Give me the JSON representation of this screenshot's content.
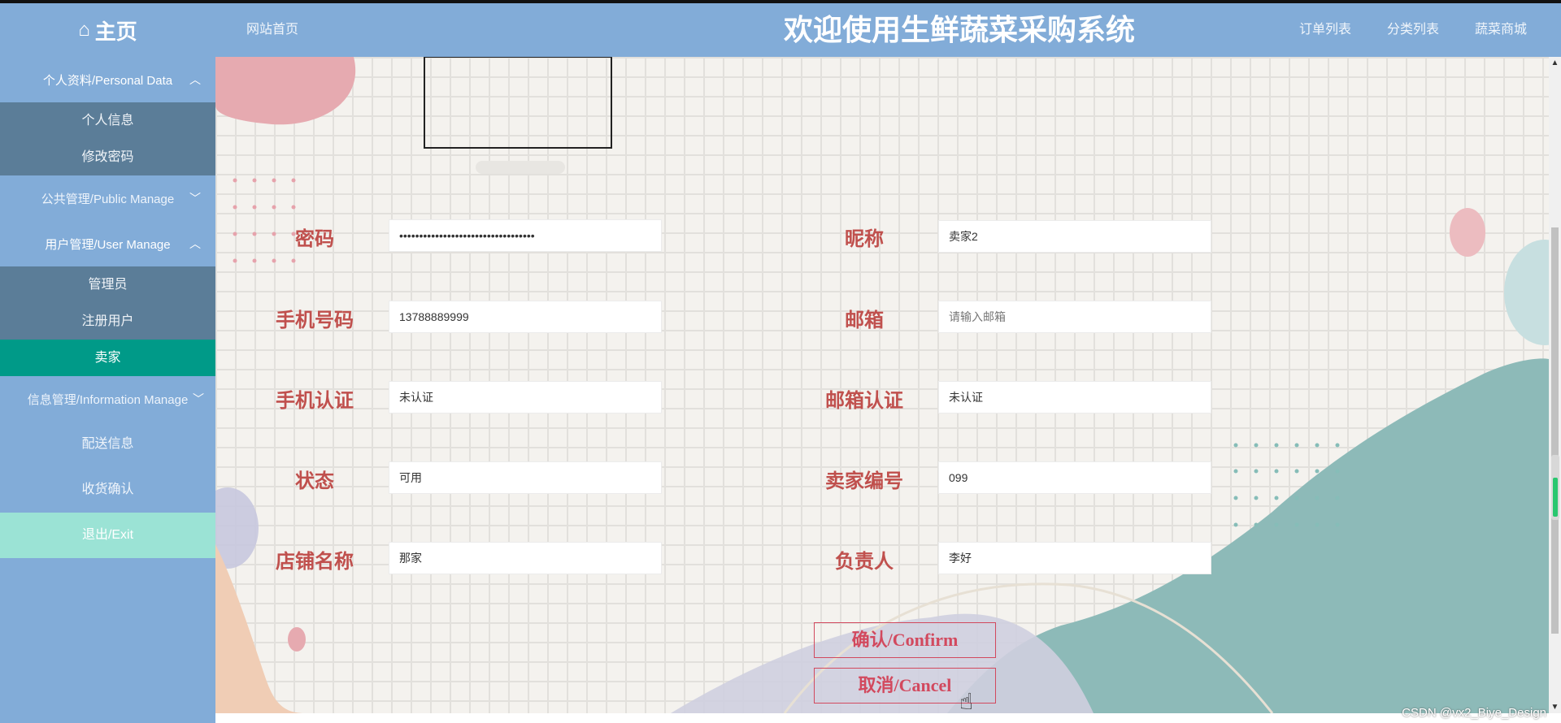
{
  "header": {
    "brand": "主页",
    "home_icon": "home-icon",
    "site_home": "网站首页",
    "title": "欢迎使用生鲜蔬菜采购系统",
    "nav": [
      "订单列表",
      "分类列表",
      "蔬菜商城"
    ]
  },
  "sidebar": {
    "groups": [
      {
        "label": "个人资料/Personal Data",
        "expanded": true,
        "items": [
          "个人信息",
          "修改密码"
        ]
      },
      {
        "label": "公共管理/Public Manage",
        "expanded": false
      },
      {
        "label": "用户管理/User Manage",
        "expanded": true,
        "items": [
          "管理员",
          "注册用户",
          "卖家"
        ],
        "active": "卖家"
      },
      {
        "label": "信息管理/Information Manage",
        "expanded": false
      }
    ],
    "plain_items": [
      "配送信息",
      "收货确认"
    ],
    "exit": "退出/Exit"
  },
  "form": {
    "password_label": "密码",
    "password_value": "••••••••••••••••••••••••••••••••••",
    "nickname_label": "昵称",
    "nickname_value": "卖家2",
    "phone_label": "手机号码",
    "phone_value": "13788889999",
    "email_label": "邮箱",
    "email_placeholder": "请输入邮箱",
    "phone_verify_label": "手机认证",
    "phone_verify_value": "未认证",
    "email_verify_label": "邮箱认证",
    "email_verify_value": "未认证",
    "status_label": "状态",
    "status_value": "可用",
    "seller_no_label": "卖家编号",
    "seller_no_value": "099",
    "shop_label": "店铺名称",
    "shop_value": "那家",
    "owner_label": "负责人",
    "owner_value": "李好"
  },
  "buttons": {
    "confirm": "确认/Confirm",
    "cancel": "取消/Cancel"
  },
  "watermark": "CSDN @vx2_Biye_Design",
  "colors": {
    "header_bg": "#82acd8",
    "submenu_bg": "#5b7d98",
    "active_bg": "#009a88",
    "exit_bg": "#9be3d5",
    "label_color": "#c0504d",
    "button_color": "#d2495e"
  }
}
